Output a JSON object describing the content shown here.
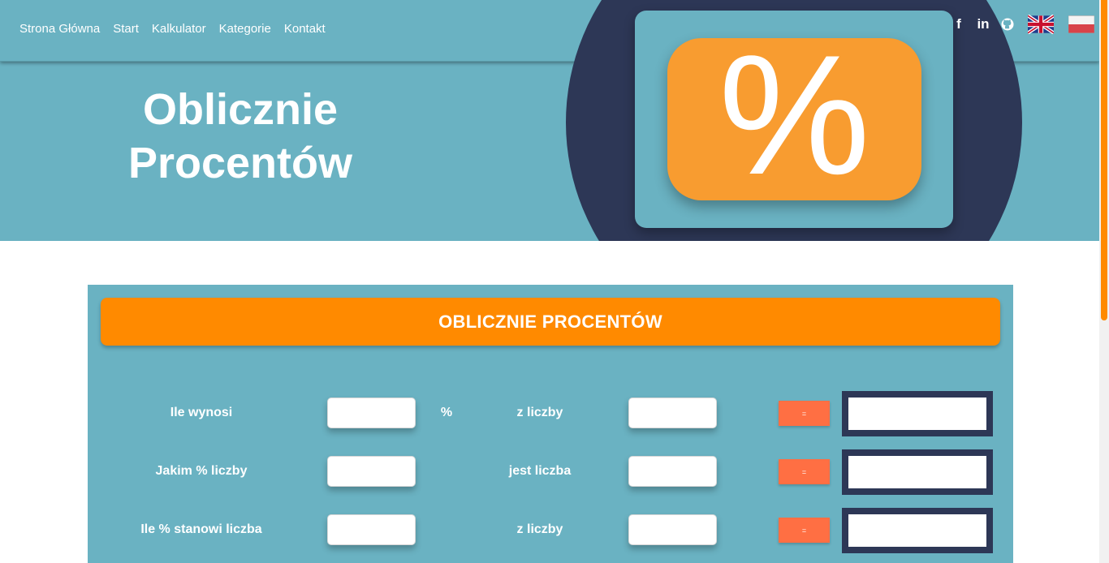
{
  "nav": {
    "links": [
      "Strona Główna",
      "Start",
      "Kalkulator",
      "Kategorie",
      "Kontakt"
    ],
    "social": [
      "f",
      "in"
    ]
  },
  "hero": {
    "title_line1": "Oblicznie",
    "title_line2": "Procentów",
    "symbol": "%"
  },
  "calculator": {
    "header": "OBLICZNIE PROCENTÓW",
    "rows": [
      {
        "label_a": "Ile wynosi",
        "middle": "%",
        "label_b": "z liczby",
        "button": "="
      },
      {
        "label_a": "Jakim % liczby",
        "middle": "",
        "label_b": "jest liczba",
        "button": "="
      },
      {
        "label_a": "Ile % stanowi liczba",
        "middle": "",
        "label_b": "z liczby",
        "button": "="
      }
    ]
  },
  "colors": {
    "teal": "#6ab2c2",
    "navy": "#2d3756",
    "orange": "#ff8a00",
    "percent_orange": "#f89c30",
    "button": "#ff6f43"
  }
}
